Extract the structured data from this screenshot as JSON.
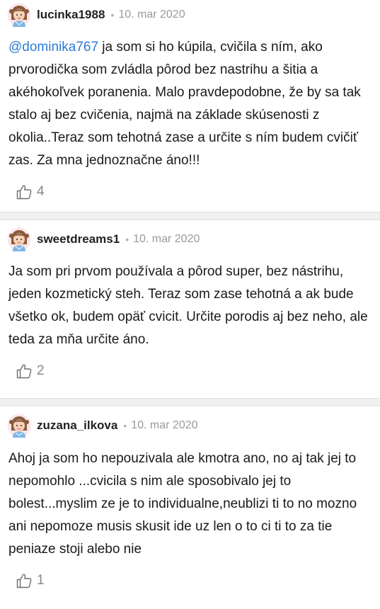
{
  "comments": [
    {
      "username": "lucinka1988",
      "date": "10. mar 2020",
      "mention": "@dominika767",
      "text": " ja som si ho kúpila, cvičila s ním, ako prvorodička som zvládla pôrod bez nastrihu a šitia a akéhokoľvek poranenia. Malo pravdepodobne, že by sa tak stalo aj bez cvičenia, najmä na základe skúsenosti z okolia..Teraz som tehotná zase a určite s ním budem cvičiť zas. Za mna jednoznačne áno!!!",
      "likes": "4"
    },
    {
      "username": "sweetdreams1",
      "date": "10. mar 2020",
      "text": "Ja som pri prvom používala a pôrod super, bez nástrihu, jeden kozmetický steh. Teraz som zase tehotná a ak bude všetko ok, budem opäť cvicit. Určite porodis aj bez neho, ale teda za mňa určite áno.",
      "likes": "2"
    },
    {
      "username": "zuzana_ilkova",
      "date": "10. mar 2020",
      "text": "Ahoj ja som ho nepouzivala ale kmotra ano, no aj tak jej to nepomohlo ...cvicila s nim ale sposobivalo jej to bolest...myslim ze je to individualne,neublizi ti to no mozno ani nepomoze musis skusit ide uz len o to ci ti to za tie peniaze stoji alebo nie",
      "likes": "1"
    }
  ],
  "separator": "•"
}
